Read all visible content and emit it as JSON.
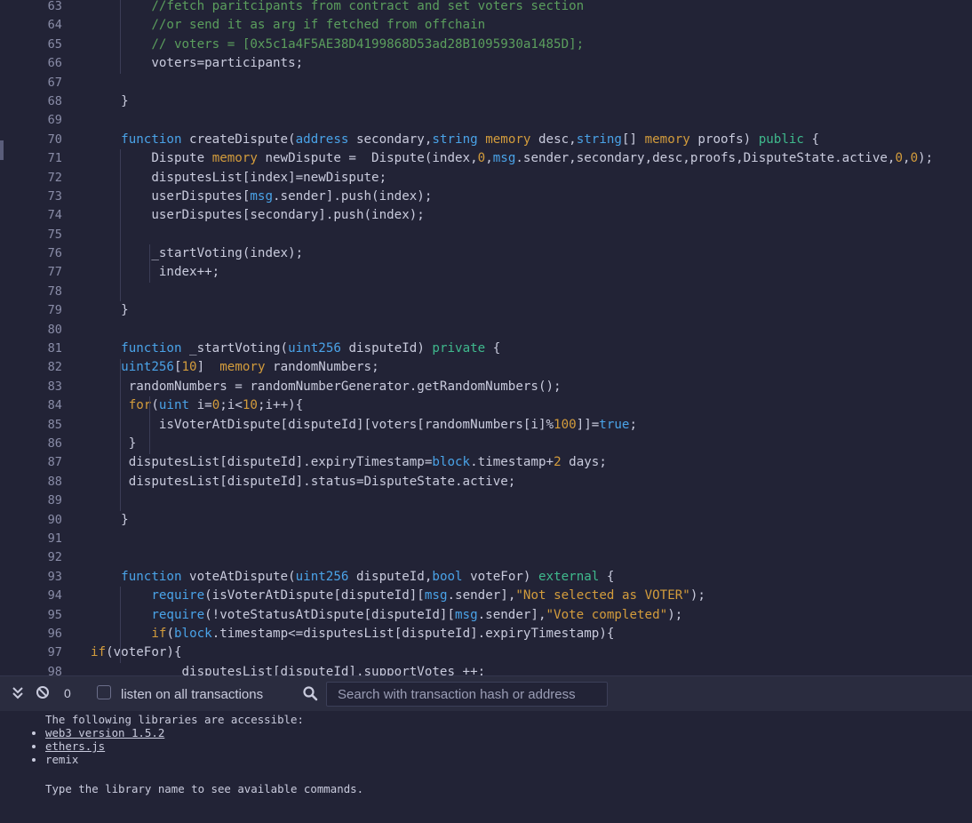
{
  "editor": {
    "line_numbers": [
      "63",
      "64",
      "65",
      "66",
      "67",
      "68",
      "69",
      "70",
      "71",
      "72",
      "73",
      "74",
      "75",
      "76",
      "77",
      "78",
      "79",
      "80",
      "81",
      "82",
      "83",
      "84",
      "85",
      "86",
      "87",
      "88",
      "89",
      "90",
      "91",
      "92",
      "93",
      "94",
      "95",
      "96",
      "97",
      "98"
    ],
    "lines": [
      {
        "indent": "        ",
        "tokens": [
          [
            "cmt",
            "//fetch paritcipants from contract and set voters section"
          ]
        ]
      },
      {
        "indent": "        ",
        "tokens": [
          [
            "cmt",
            "//or send it as arg if fetched from offchain"
          ]
        ]
      },
      {
        "indent": "        ",
        "tokens": [
          [
            "cmt",
            "// voters = [0x5c1a4F5AE38D4199868D53ad28B1095930a1485D];"
          ]
        ]
      },
      {
        "indent": "        ",
        "tokens": [
          [
            "plain",
            "voters=participants;"
          ]
        ]
      },
      {
        "indent": "",
        "tokens": []
      },
      {
        "indent": "    ",
        "tokens": [
          [
            "plain",
            "}"
          ]
        ]
      },
      {
        "indent": "",
        "tokens": []
      },
      {
        "indent": "    ",
        "tokens": [
          [
            "kw",
            "function"
          ],
          [
            "plain",
            " createDispute("
          ],
          [
            "kw",
            "address"
          ],
          [
            "plain",
            " secondary,"
          ],
          [
            "kw",
            "string"
          ],
          [
            "plain",
            " "
          ],
          [
            "mem",
            "memory"
          ],
          [
            "plain",
            " desc,"
          ],
          [
            "kw",
            "string"
          ],
          [
            "plain",
            "[] "
          ],
          [
            "mem",
            "memory"
          ],
          [
            "plain",
            " proofs) "
          ],
          [
            "vis",
            "public"
          ],
          [
            "plain",
            " {"
          ]
        ]
      },
      {
        "indent": "        ",
        "tokens": [
          [
            "plain",
            "Dispute "
          ],
          [
            "mem",
            "memory"
          ],
          [
            "plain",
            " newDispute =  Dispute(index,"
          ],
          [
            "num",
            "0"
          ],
          [
            "plain",
            ","
          ],
          [
            "kw",
            "msg"
          ],
          [
            "plain",
            ".sender,secondary,desc,proofs,DisputeState.active,"
          ],
          [
            "num",
            "0"
          ],
          [
            "plain",
            ","
          ],
          [
            "num",
            "0"
          ],
          [
            "plain",
            ");"
          ]
        ]
      },
      {
        "indent": "        ",
        "tokens": [
          [
            "plain",
            "disputesList[index]=newDispute;"
          ]
        ]
      },
      {
        "indent": "        ",
        "tokens": [
          [
            "plain",
            "userDisputes["
          ],
          [
            "kw",
            "msg"
          ],
          [
            "plain",
            ".sender].push(index);"
          ]
        ]
      },
      {
        "indent": "        ",
        "tokens": [
          [
            "plain",
            "userDisputes[secondary].push(index);"
          ]
        ]
      },
      {
        "indent": "",
        "tokens": []
      },
      {
        "indent": "        ",
        "tokens": [
          [
            "plain",
            "_startVoting(index);"
          ]
        ]
      },
      {
        "indent": "         ",
        "tokens": [
          [
            "plain",
            "index++;"
          ]
        ]
      },
      {
        "indent": "",
        "tokens": []
      },
      {
        "indent": "    ",
        "tokens": [
          [
            "plain",
            "}"
          ]
        ]
      },
      {
        "indent": "",
        "tokens": []
      },
      {
        "indent": "    ",
        "tokens": [
          [
            "kw",
            "function"
          ],
          [
            "plain",
            " _startVoting("
          ],
          [
            "kw",
            "uint256"
          ],
          [
            "plain",
            " disputeId) "
          ],
          [
            "vis",
            "private"
          ],
          [
            "plain",
            " {"
          ]
        ]
      },
      {
        "indent": "    ",
        "tokens": [
          [
            "kw",
            "uint256"
          ],
          [
            "plain",
            "["
          ],
          [
            "num",
            "10"
          ],
          [
            "plain",
            "]  "
          ],
          [
            "mem",
            "memory"
          ],
          [
            "plain",
            " randomNumbers;"
          ]
        ]
      },
      {
        "indent": "     ",
        "tokens": [
          [
            "plain",
            "randomNumbers = randomNumberGenerator.getRandomNumbers();"
          ]
        ]
      },
      {
        "indent": "     ",
        "tokens": [
          [
            "mem",
            "for"
          ],
          [
            "plain",
            "("
          ],
          [
            "kw",
            "uint"
          ],
          [
            "plain",
            " i="
          ],
          [
            "num",
            "0"
          ],
          [
            "plain",
            ";i<"
          ],
          [
            "num",
            "10"
          ],
          [
            "plain",
            ";i++){"
          ]
        ]
      },
      {
        "indent": "         ",
        "tokens": [
          [
            "plain",
            "isVoterAtDispute[disputeId][voters[randomNumbers[i]%"
          ],
          [
            "num",
            "100"
          ],
          [
            "plain",
            "]]="
          ],
          [
            "kw",
            "true"
          ],
          [
            "plain",
            ";"
          ]
        ]
      },
      {
        "indent": "     ",
        "tokens": [
          [
            "plain",
            "}"
          ]
        ]
      },
      {
        "indent": "     ",
        "tokens": [
          [
            "plain",
            "disputesList[disputeId].expiryTimestamp="
          ],
          [
            "kw",
            "block"
          ],
          [
            "plain",
            ".timestamp+"
          ],
          [
            "num",
            "2"
          ],
          [
            "plain",
            " days;"
          ]
        ]
      },
      {
        "indent": "     ",
        "tokens": [
          [
            "plain",
            "disputesList[disputeId].status=DisputeState.active;"
          ]
        ]
      },
      {
        "indent": "",
        "tokens": []
      },
      {
        "indent": "    ",
        "tokens": [
          [
            "plain",
            "}"
          ]
        ]
      },
      {
        "indent": "",
        "tokens": []
      },
      {
        "indent": "",
        "tokens": []
      },
      {
        "indent": "    ",
        "tokens": [
          [
            "kw",
            "function"
          ],
          [
            "plain",
            " voteAtDispute("
          ],
          [
            "kw",
            "uint256"
          ],
          [
            "plain",
            " disputeId,"
          ],
          [
            "kw",
            "bool"
          ],
          [
            "plain",
            " voteFor) "
          ],
          [
            "vis",
            "external"
          ],
          [
            "plain",
            " {"
          ]
        ]
      },
      {
        "indent": "        ",
        "tokens": [
          [
            "kw",
            "require"
          ],
          [
            "plain",
            "(isVoterAtDispute[disputeId]["
          ],
          [
            "kw",
            "msg"
          ],
          [
            "plain",
            ".sender],"
          ],
          [
            "str",
            "\"Not selected as VOTER\""
          ],
          [
            "plain",
            ");"
          ]
        ]
      },
      {
        "indent": "        ",
        "tokens": [
          [
            "kw",
            "require"
          ],
          [
            "plain",
            "(!voteStatusAtDispute[disputeId]["
          ],
          [
            "kw",
            "msg"
          ],
          [
            "plain",
            ".sender],"
          ],
          [
            "str",
            "\"Vote completed\""
          ],
          [
            "plain",
            ");"
          ]
        ]
      },
      {
        "indent": "        ",
        "tokens": [
          [
            "mem",
            "if"
          ],
          [
            "plain",
            "("
          ],
          [
            "kw",
            "block"
          ],
          [
            "plain",
            ".timestamp<=disputesList[disputeId].expiryTimestamp){"
          ]
        ]
      },
      {
        "indent": "",
        "tokens": [
          [
            "mem",
            "if"
          ],
          [
            "plain",
            "(voteFor){"
          ]
        ]
      },
      {
        "indent": "            ",
        "tokens": [
          [
            "plain",
            "disputesList[disputeId].supportVotes ++;"
          ]
        ]
      }
    ]
  },
  "terminal": {
    "log_count": "0",
    "listen_label": "listen on all transactions",
    "search_placeholder": "Search with transaction hash or address",
    "intro": "The following libraries are accessible:",
    "libraries": [
      "web3 version 1.5.2",
      "ethers.js",
      "remix"
    ],
    "hint": "Type the library name to see available commands."
  },
  "colors": {
    "background": "#222336",
    "keyword": "#4aa3e8",
    "memory_keyword": "#d39c3c",
    "visibility": "#3fb98d",
    "comment": "#5b9e5d"
  },
  "icons": {
    "collapse": "double-chevron-down-icon",
    "clear": "clear-console-icon",
    "search": "search-icon"
  }
}
